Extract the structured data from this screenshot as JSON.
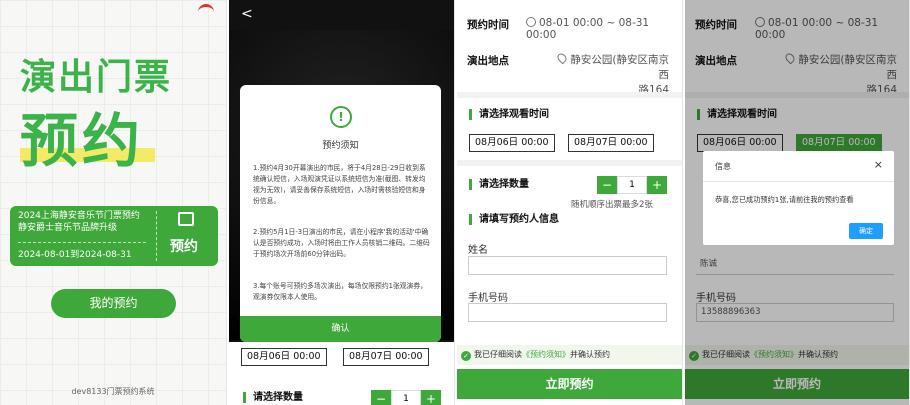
{
  "panel1": {
    "hero_line1": "演出门票",
    "hero_line2": "预约",
    "card_title_line1": "2024上海静安音乐节门票预约",
    "card_title_line2": "静安爵士音乐节品牌升级",
    "card_dates": "2024-08-01到2024-08-31",
    "card_action": "预约",
    "my_booking": "我的预约",
    "footer": "dev8133门票预约系统"
  },
  "panel2": {
    "back": "<",
    "modal_icon": "!",
    "modal_title": "预约须知",
    "para1": "1.预约4月30开幕演出的市民，将于4月28日-29日收到系统确认短信，入场观演凭证以系统短信为准(截图、转发均视为无效)，请妥善保存系统短信，入场时需核验短信和身份信息。",
    "para2": "2.预约5月1日-3日演出的市民，请在小程序'我的活动'中确认是否预约成功，入场时将由工作人员核销二维码。二维码于预约场次开场前60分钟出码。",
    "para3": "3.每个账号可预约多场次演出，每场仅限预约1张观演券，观演券仅限本人使用。",
    "confirm": "确认",
    "date1": "08月06日 00:00",
    "date2": "08月07日 00:00",
    "qty_title": "请选择数量"
  },
  "panel3": {
    "time_label": "预约时间",
    "time_value": "08-01 00:00 ~ 08-31 00:00",
    "place_label": "演出地点",
    "place_value1": "静安公园(静安区南京西",
    "place_value2": "路164",
    "choose_time": "请选择观看时间",
    "date1": "08月06日 00:00",
    "date2": "08月07日 00:00",
    "choose_qty": "请选择数量",
    "minus": "−",
    "qty": "1",
    "plus": "+",
    "qty_hint": "随机顺序出票最多2张",
    "fill_info": "请填写预约人信息",
    "name_label": "姓名",
    "phone_label": "手机号码",
    "agree_prefix": "我已仔细阅读",
    "agree_link": "《预约须知》",
    "agree_suffix": "并确认预约",
    "submit": "立即预约"
  },
  "panel4": {
    "time_label": "预约时间",
    "time_value": "08-01 00:00 ~ 08-31 00:00",
    "place_label": "演出地点",
    "place_value1": "静安公园(静安区南京西",
    "place_value2": "路164",
    "choose_time": "请选择观看时间",
    "date1": "08月06日 00:00",
    "date2": "08月07日 00:00",
    "name_value": "陈诚",
    "phone_label": "手机号码",
    "phone_value": "13588896363",
    "agree_prefix": "我已仔细阅读",
    "agree_link": "《预约须知》",
    "agree_suffix": "并确认预约",
    "submit": "立即预约",
    "dialog_title": "信息",
    "dialog_close": "×",
    "dialog_msg": "恭喜,您已成功预约1张,请前往我的预约查看",
    "dialog_ok": "确定"
  },
  "colors": {
    "brand_green": "#3fa83a",
    "dialog_blue": "#1e9fff"
  }
}
